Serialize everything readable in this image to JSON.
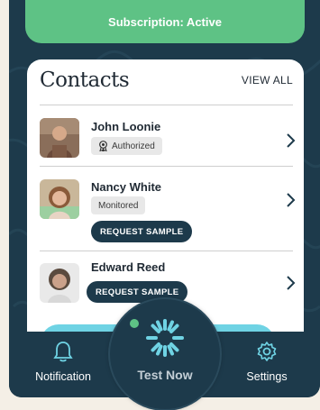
{
  "subscription": {
    "label": "Subscription: Active"
  },
  "contacts": {
    "title": "Contacts",
    "view_all": "VIEW ALL",
    "items": [
      {
        "name": "John Loonie",
        "status": "Authorized",
        "action": ""
      },
      {
        "name": "Nancy White",
        "status": "Monitored",
        "action": "REQUEST SAMPLE"
      },
      {
        "name": "Edward Reed",
        "status": "",
        "action": "REQUEST SAMPLE"
      }
    ]
  },
  "nav": {
    "notification": "Notification",
    "test_now": "Test Now",
    "settings": "Settings"
  },
  "colors": {
    "navy": "#1d3a4b",
    "green": "#5ec285",
    "cyan": "#6fd3e4",
    "cream": "#f4efe6"
  }
}
